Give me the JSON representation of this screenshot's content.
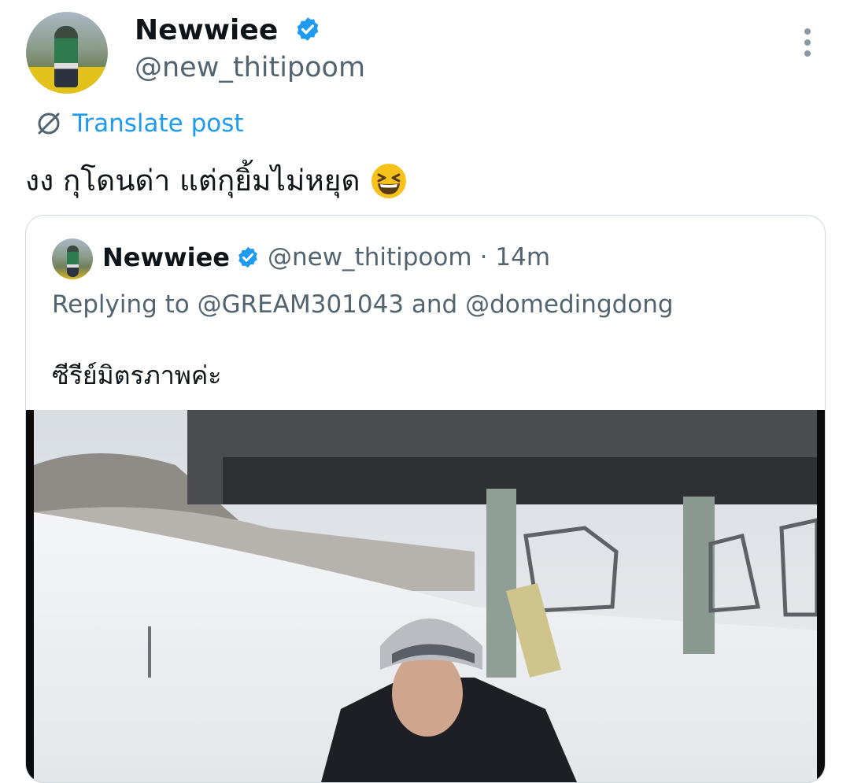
{
  "post": {
    "author_name": "Newwiee",
    "author_handle": "@new_thitipoom",
    "translate_label": "Translate post",
    "text": "งง กุโดนด่า แต่กุยิ้มไม่หยุด",
    "emoji": "grinning-squinting-face-emoji"
  },
  "quoted": {
    "author_name": "Newwiee",
    "author_handle": "@new_thitipoom",
    "separator": "·",
    "time": "14m",
    "replying_to": "Replying to @GREAM301043 and @domedingdong",
    "text": "ซีรีย์มิตรภาพค่ะ"
  },
  "colors": {
    "accent": "#1d9bf0",
    "secondary_text": "#536471",
    "border": "#cfd9de"
  }
}
